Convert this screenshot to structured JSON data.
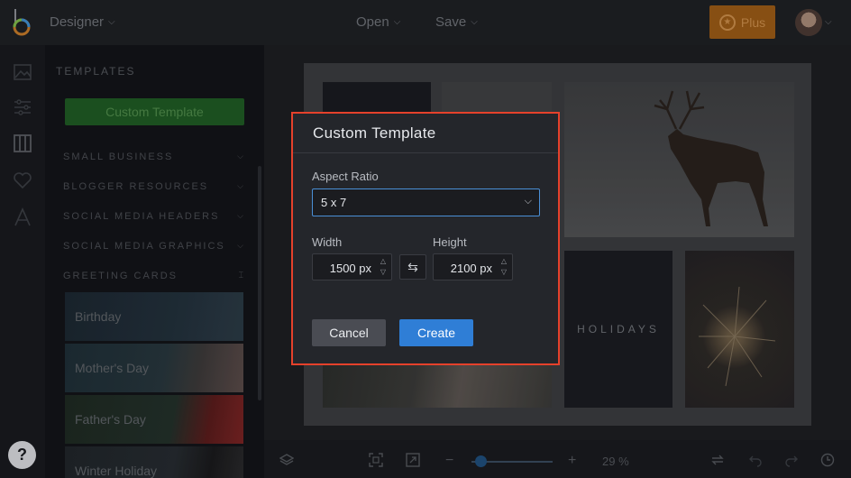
{
  "topbar": {
    "app_menu": "Designer",
    "open_label": "Open",
    "save_label": "Save",
    "plus_label": "Plus"
  },
  "templates_panel": {
    "title": "TEMPLATES",
    "custom_template_button": "Custom Template",
    "categories": [
      {
        "label": "SMALL BUSINESS",
        "chevron": "chevron-down-icon"
      },
      {
        "label": "BLOGGER RESOURCES",
        "chevron": "chevron-down-icon"
      },
      {
        "label": "SOCIAL MEDIA HEADERS",
        "chevron": "chevron-down-icon"
      },
      {
        "label": "SOCIAL MEDIA GRAPHICS",
        "chevron": "chevron-down-icon"
      },
      {
        "label": "GREETING CARDS",
        "chevron": "chevron-up-icon"
      }
    ],
    "greeting_cards": [
      {
        "label": "Birthday"
      },
      {
        "label": "Mother's Day"
      },
      {
        "label": "Father's Day"
      },
      {
        "label": "Winter Holiday"
      }
    ]
  },
  "canvas": {
    "holidays_text": "HOLIDAYS"
  },
  "bottombar": {
    "zoom_level": "29 %",
    "zoom_fraction": 0.05
  },
  "dialog": {
    "title": "Custom Template",
    "aspect_ratio_label": "Aspect Ratio",
    "aspect_ratio_value": "5 x 7",
    "width_label": "Width",
    "width_value": "1500 px",
    "height_label": "Height",
    "height_value": "2100 px",
    "cancel_label": "Cancel",
    "create_label": "Create"
  },
  "colors": {
    "accent_blue": "#2f7ed6",
    "highlight_red": "#e5412b",
    "plus_orange": "#9a5a16",
    "custom_green": "#1f5a24"
  }
}
